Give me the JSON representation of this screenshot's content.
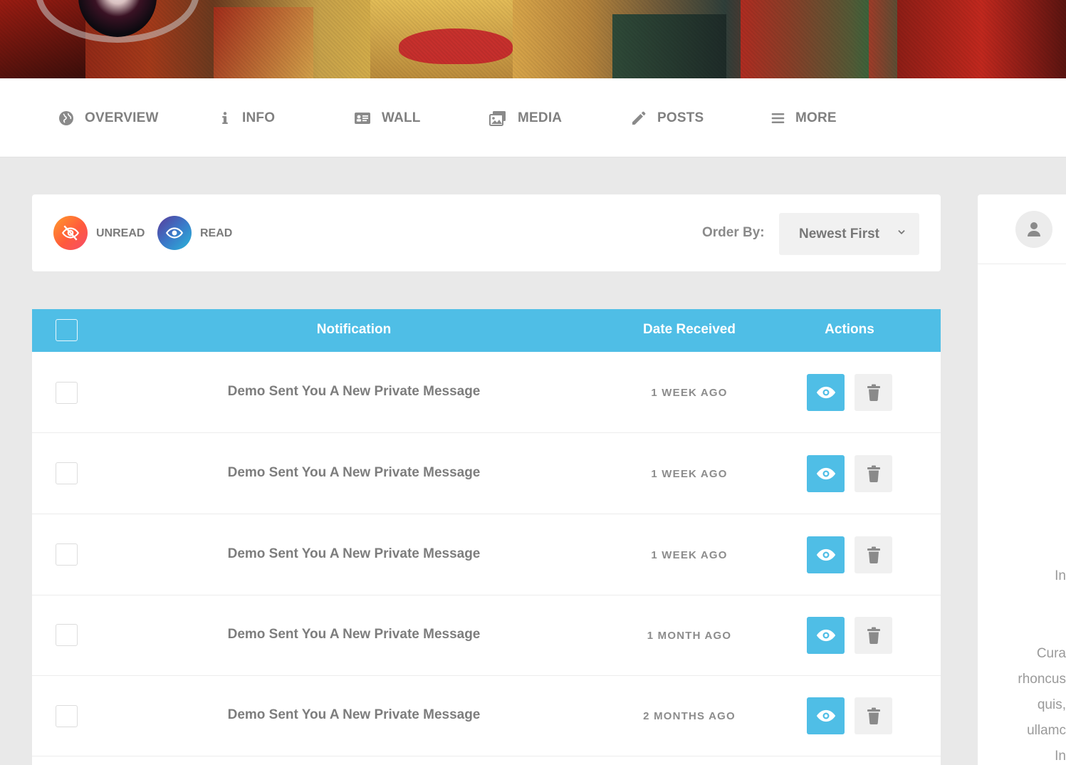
{
  "nav": {
    "items": [
      {
        "label": "OVERVIEW",
        "icon": "globe-icon"
      },
      {
        "label": "INFO",
        "icon": "info-icon"
      },
      {
        "label": "WALL",
        "icon": "id-card-icon"
      },
      {
        "label": "MEDIA",
        "icon": "images-icon"
      },
      {
        "label": "POSTS",
        "icon": "pencil-icon"
      },
      {
        "label": "MORE",
        "icon": "menu-icon"
      }
    ]
  },
  "filter": {
    "unread_label": "UNREAD",
    "read_label": "READ",
    "order_label": "Order By:",
    "order_value": "Newest First"
  },
  "table": {
    "headers": {
      "notification": "Notification",
      "date": "Date Received",
      "actions": "Actions"
    },
    "rows": [
      {
        "message": "Demo Sent You A New Private Message",
        "date": "1 WEEK AGO"
      },
      {
        "message": "Demo Sent You A New Private Message",
        "date": "1 WEEK AGO"
      },
      {
        "message": "Demo Sent You A New Private Message",
        "date": "1 WEEK AGO"
      },
      {
        "message": "Demo Sent You A New Private Message",
        "date": "1 MONTH AGO"
      },
      {
        "message": "Demo Sent You A New Private Message",
        "date": "2 MONTHS AGO"
      }
    ]
  },
  "side": {
    "lines": [
      "In",
      "Cura",
      "rhoncus",
      "quis,",
      "ullamc",
      "In"
    ]
  },
  "colors": {
    "accent": "#4fbee6",
    "unread_gradient_start": "#ff9a2a",
    "unread_gradient_end": "#f64d6b",
    "read_gradient_start": "#5a3a9a",
    "read_gradient_end": "#2bb5d9"
  }
}
